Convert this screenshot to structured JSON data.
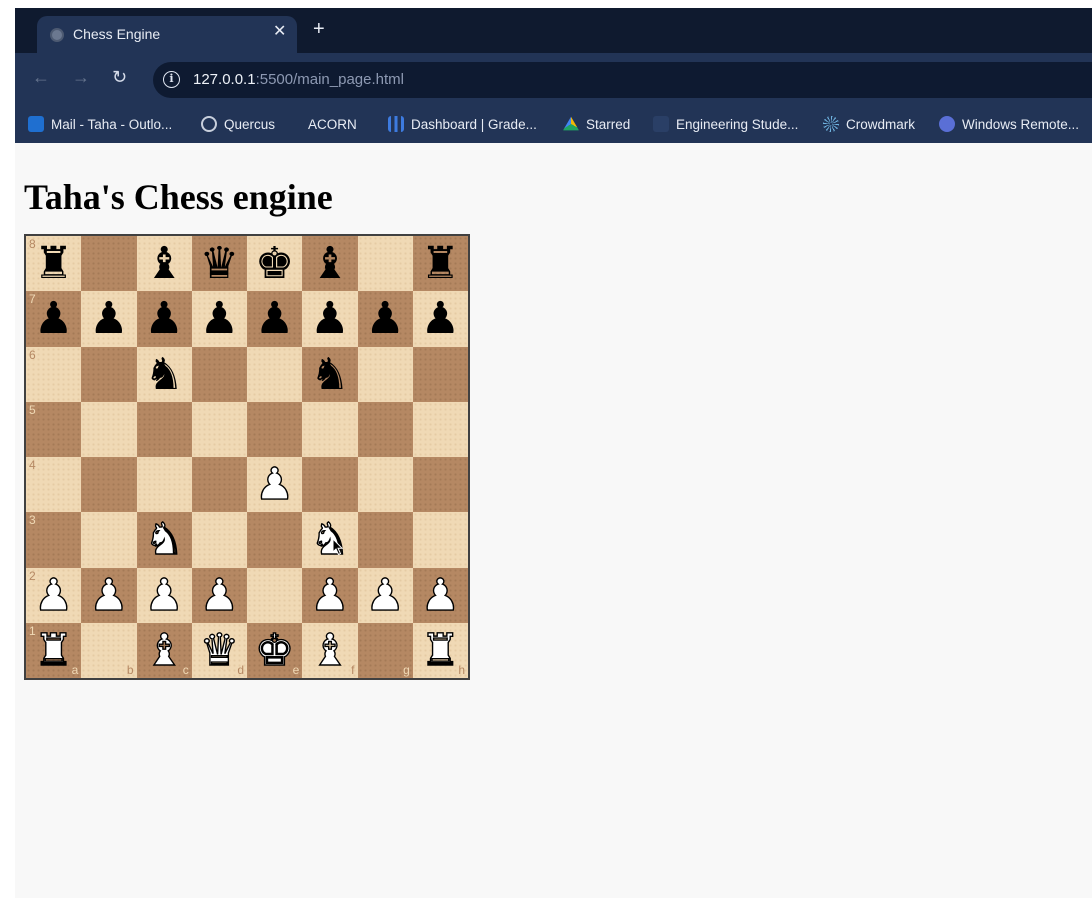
{
  "browser": {
    "tab_title": "Chess Engine",
    "tab_close": "✕",
    "new_tab": "+",
    "url_host": "127.0.0.1",
    "url_path": ":5500/main_page.html",
    "back": "←",
    "forward": "→",
    "reload": "↻",
    "info": "i"
  },
  "bookmarks": [
    {
      "label": "Mail - Taha - Outlo...",
      "icon": "outlook-icon",
      "color": "#1f6fd0"
    },
    {
      "label": "Quercus",
      "icon": "globe-icon",
      "color": "#c8cfdc"
    },
    {
      "label": "ACORN",
      "icon": "none",
      "color": ""
    },
    {
      "label": "Dashboard | Grade...",
      "icon": "bar-chart-icon",
      "color": "#3d7be0"
    },
    {
      "label": "Starred",
      "icon": "google-drive-icon",
      "color": "#f2b705"
    },
    {
      "label": "Engineering Stude...",
      "icon": "folder-icon",
      "color": "#2a3f66"
    },
    {
      "label": "Crowdmark",
      "icon": "crowdmark-icon",
      "color": "#6fb3e0"
    },
    {
      "label": "Windows Remote...",
      "icon": "windows-remote-icon",
      "color": "#5a6fd6"
    }
  ],
  "page": {
    "title": "Taha's Chess engine"
  },
  "board": {
    "ranks": [
      "8",
      "7",
      "6",
      "5",
      "4",
      "3",
      "2",
      "1"
    ],
    "files": [
      "a",
      "b",
      "c",
      "d",
      "e",
      "f",
      "g",
      "h"
    ],
    "light_color": "#f0d9b5",
    "dark_color": "#b58863",
    "position": [
      [
        "br",
        "",
        "bb",
        "bq",
        "bk",
        "bb",
        "",
        "br"
      ],
      [
        "bp",
        "bp",
        "bp",
        "bp",
        "bp",
        "bp",
        "bp",
        "bp"
      ],
      [
        "",
        "",
        "bn",
        "",
        "",
        "bn",
        "",
        ""
      ],
      [
        "",
        "",
        "",
        "",
        "",
        "",
        "",
        ""
      ],
      [
        "",
        "",
        "",
        "",
        "wp",
        "",
        "",
        ""
      ],
      [
        "",
        "",
        "wn",
        "",
        "",
        "wn",
        "",
        ""
      ],
      [
        "wp",
        "wp",
        "wp",
        "wp",
        "",
        "wp",
        "wp",
        "wp"
      ],
      [
        "wr",
        "",
        "wb",
        "wq",
        "wk",
        "wb",
        "",
        "wr"
      ]
    ]
  }
}
